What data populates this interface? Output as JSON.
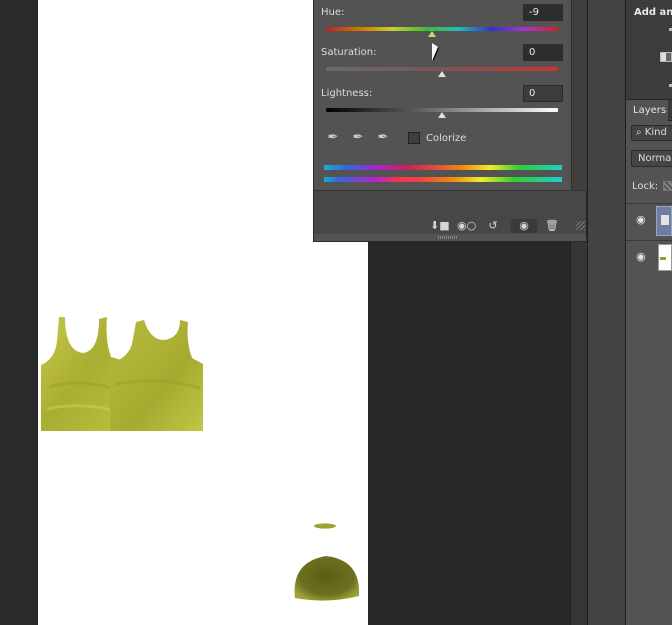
{
  "properties_panel": {
    "hue_label": "Hue:",
    "hue_value": "-9",
    "saturation_label": "Saturation:",
    "saturation_value": "0",
    "lightness_label": "Lightness:",
    "lightness_value": "0",
    "colorize_label": "Colorize",
    "colorize_checked": false,
    "hue_level": -9,
    "saturation_level": 0,
    "lightness_level": 0
  },
  "adjustments_panel": {
    "title": "Add an a"
  },
  "layers_panel": {
    "tab_label": "Layers",
    "kind_filter": "Kind",
    "blend_mode": "Normal",
    "lock_label": "Lock:"
  },
  "colors": {
    "workspace": "#282828",
    "panel": "#535353",
    "canvas": "#ffffff",
    "garment": "#b7bb3a"
  },
  "icons": {
    "eyedropper": "eyedropper-icon",
    "visibility": "eye-icon",
    "trash": "trash-icon",
    "reset": "reset-icon",
    "clip": "clip-to-layer-icon"
  }
}
